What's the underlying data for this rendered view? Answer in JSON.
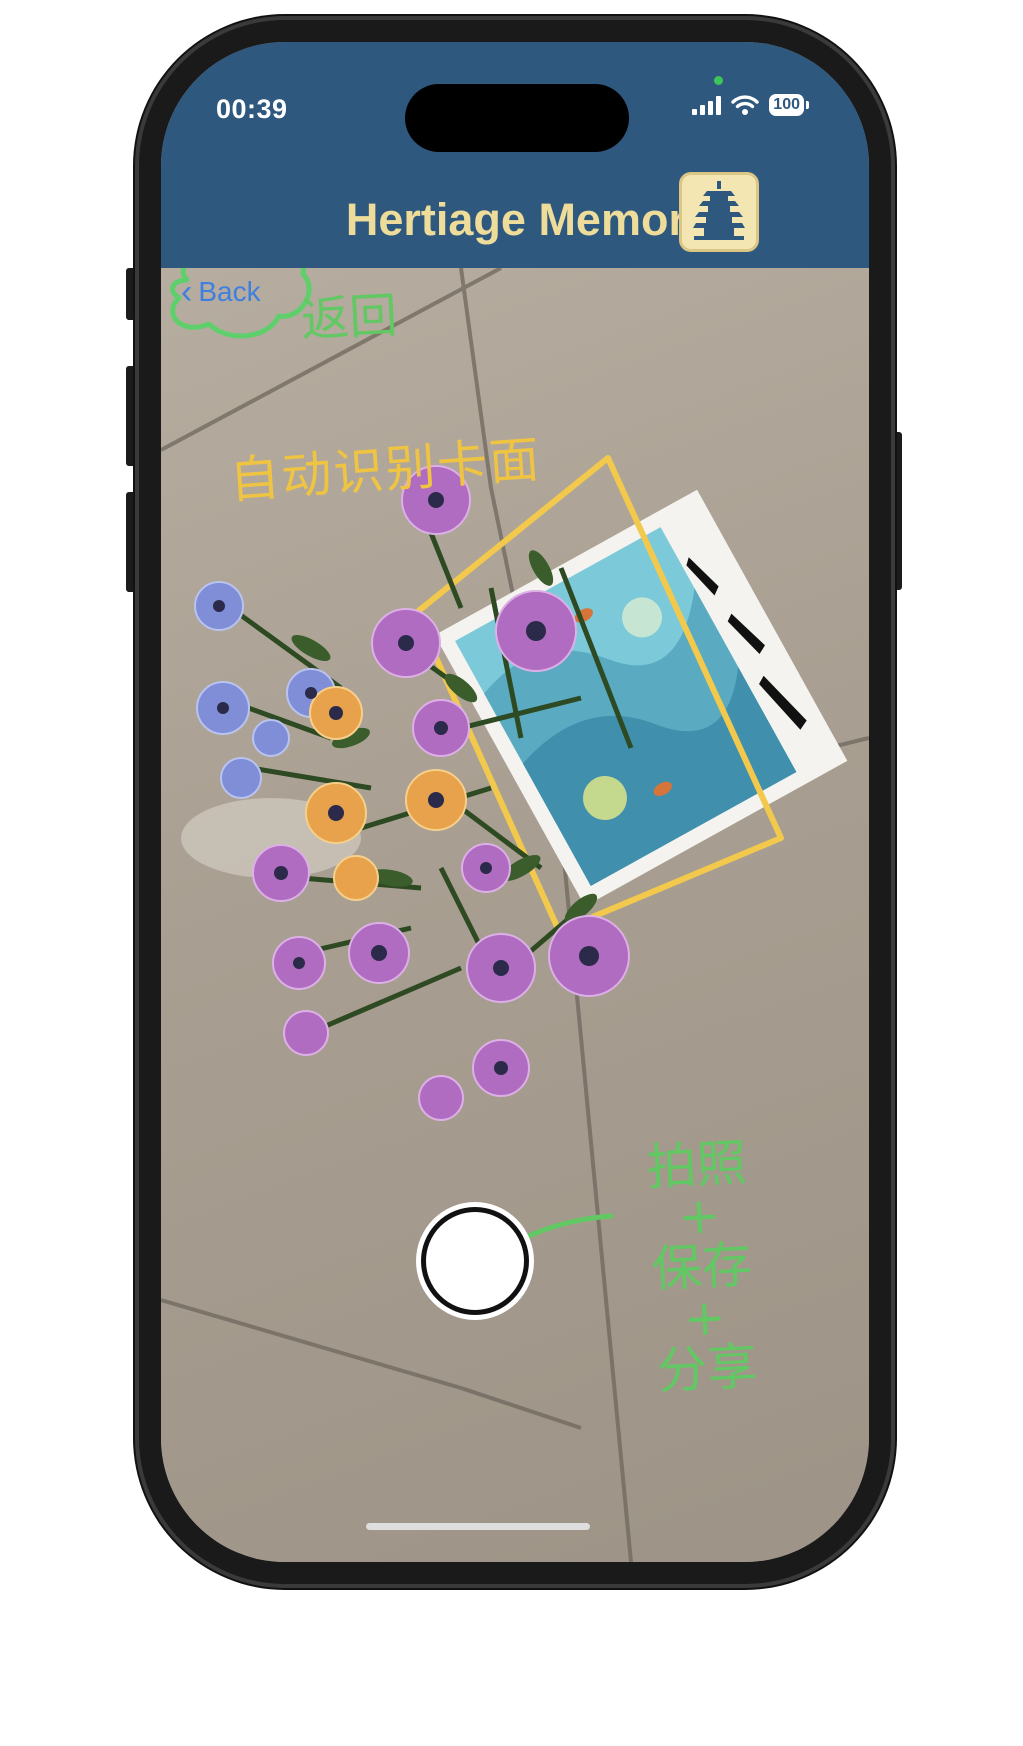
{
  "status_bar": {
    "time": "00:39",
    "battery": "100",
    "icons": [
      "cellular-signal-icon",
      "wifi-icon",
      "battery-icon"
    ]
  },
  "header": {
    "title": "Hertiage Memory",
    "logo_icon": "pagoda-logo-icon",
    "background": "#2f587f",
    "title_color": "#eddc9a"
  },
  "navigation": {
    "back_label": "Back",
    "back_icon": "chevron-left-icon"
  },
  "annotations": {
    "back_note": "返回",
    "detect_note": "自动识别卡面",
    "capture_note_lines": [
      "拍照",
      "+",
      "保存",
      "+",
      "分享"
    ],
    "green": "#62c863",
    "yellow": "#efc443"
  },
  "controls": {
    "shutter_icon": "shutter-button"
  }
}
